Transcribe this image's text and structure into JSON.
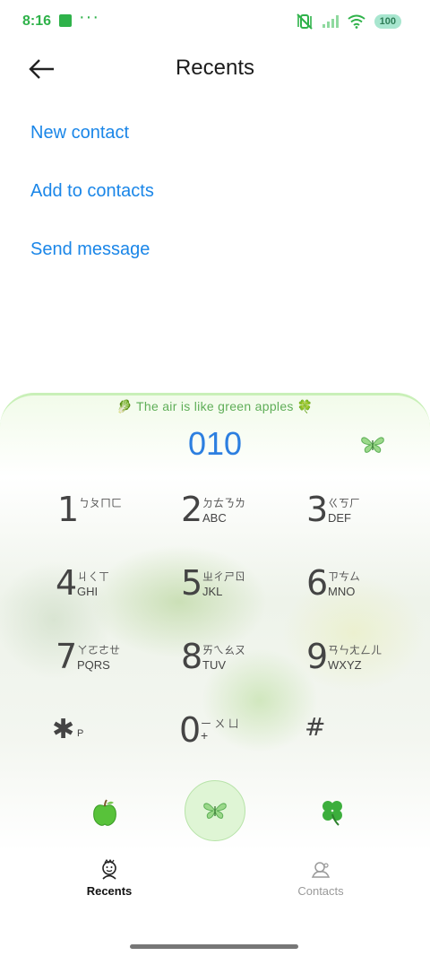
{
  "status_bar": {
    "time": "8:16",
    "notif_dots": "···",
    "battery": "100",
    "icons": [
      "vibrate-off-icon",
      "signal-icon",
      "wifi-icon",
      "battery-icon"
    ],
    "accent": "#2fb24a"
  },
  "header": {
    "title": "Recents",
    "back_icon": "arrow-left-icon"
  },
  "actions": [
    {
      "label": "New contact"
    },
    {
      "label": "Add to contacts"
    },
    {
      "label": "Send message"
    }
  ],
  "dialer": {
    "banner": "🥬 The air is like green apples 🍀",
    "number": "010",
    "number_color": "#2d7fe0",
    "keys": [
      {
        "digit": "1",
        "zhuyin": "ㄅㄆㄇㄈ",
        "letters": ""
      },
      {
        "digit": "2",
        "zhuyin": "ㄉㄊㄋㄌ",
        "letters": "ABC"
      },
      {
        "digit": "3",
        "zhuyin": "ㄍㄎㄏ",
        "letters": "DEF"
      },
      {
        "digit": "4",
        "zhuyin": "ㄐㄑㄒ",
        "letters": "GHI"
      },
      {
        "digit": "5",
        "zhuyin": "ㄓㄔㄕㄖ",
        "letters": "JKL"
      },
      {
        "digit": "6",
        "zhuyin": "ㄗㄘㄙ",
        "letters": "MNO"
      },
      {
        "digit": "7",
        "zhuyin": "ㄚㄛㄜㄝ",
        "letters": "PQRS"
      },
      {
        "digit": "8",
        "zhuyin": "ㄞㄟㄠㄡ",
        "letters": "TUV"
      },
      {
        "digit": "9",
        "zhuyin": "ㄢㄣㄤㄥㄦ",
        "letters": "WXYZ"
      },
      {
        "digit": "✱",
        "zhuyin": "",
        "letters": "P"
      },
      {
        "digit": "0",
        "zhuyin": "ー ㄨ ㄩ",
        "letters": "+"
      },
      {
        "digit": "#",
        "zhuyin": "",
        "letters": ""
      }
    ]
  },
  "nav": {
    "recents_label": "Recents",
    "contacts_label": "Contacts"
  }
}
